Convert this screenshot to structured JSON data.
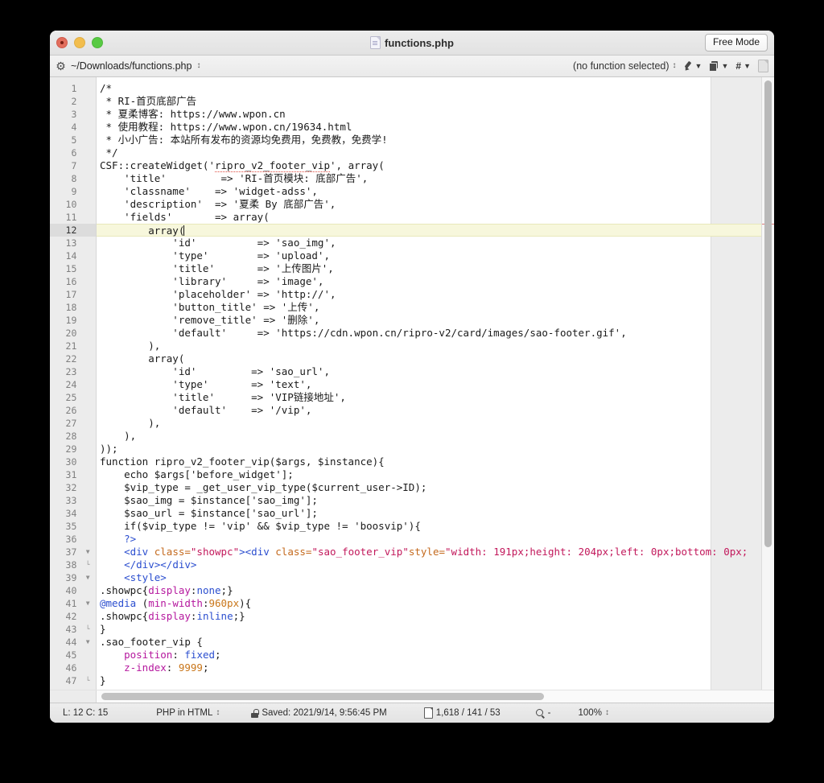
{
  "window": {
    "title": "functions.php",
    "title_icon": "php-file-icon",
    "free_mode_label": "Free Mode",
    "traffic_lights": [
      "close-button",
      "minimize-button",
      "maximize-button"
    ]
  },
  "toolbar": {
    "gear_icon": "gear-icon",
    "path": "~/Downloads/functions.php",
    "path_stepper": "⌃⌄",
    "function_selector": "(no function selected)",
    "icons": [
      "pen-icon",
      "chevron-down-icon",
      "pages-icon",
      "chevron-down-icon",
      "hash-icon",
      "chevron-down-icon",
      "page-icon"
    ]
  },
  "editor": {
    "active_line": 12,
    "margin_guide_column": 80,
    "lines": [
      {
        "n": 1,
        "fold": "",
        "html": "/*"
      },
      {
        "n": 2,
        "fold": "",
        "html": " * RI-首页底部广告"
      },
      {
        "n": 3,
        "fold": "",
        "html": " * 夏柔博客: https://www.wpon.cn"
      },
      {
        "n": 4,
        "fold": "",
        "html": " * 使用教程: https://www.wpon.cn/19634.html"
      },
      {
        "n": 5,
        "fold": "",
        "html": " * 小小广告: 本站所有发布的资源均免费用，免费教，免费学!"
      },
      {
        "n": 6,
        "fold": "",
        "html": " */"
      },
      {
        "n": 7,
        "fold": "",
        "html": "CSF::createWidget('<span class=\"spell\">ripro_v2_footer_vip</span>', array("
      },
      {
        "n": 8,
        "fold": "",
        "html": "    'title'         => 'RI-首页模块: 底部广告',"
      },
      {
        "n": 9,
        "fold": "",
        "html": "    'classname'    => 'widget-adss',"
      },
      {
        "n": 10,
        "fold": "",
        "html": "    'description'  => '夏柔 By 底部广告',"
      },
      {
        "n": 11,
        "fold": "",
        "html": "    'fields'       => array("
      },
      {
        "n": 12,
        "fold": "",
        "html": "        array(<span class=\"caret\"></span>"
      },
      {
        "n": 13,
        "fold": "",
        "html": "            'id'          => 'sao_img',"
      },
      {
        "n": 14,
        "fold": "",
        "html": "            'type'        => 'upload',"
      },
      {
        "n": 15,
        "fold": "",
        "html": "            'title'       => '上传图片',"
      },
      {
        "n": 16,
        "fold": "",
        "html": "            'library'     => 'image',"
      },
      {
        "n": 17,
        "fold": "",
        "html": "            'placeholder' => 'http://',"
      },
      {
        "n": 18,
        "fold": "",
        "html": "            'button_title' => '上传',"
      },
      {
        "n": 19,
        "fold": "",
        "html": "            'remove_title' => '删除',"
      },
      {
        "n": 20,
        "fold": "",
        "html": "            'default'     => 'https://cdn.wpon.cn/ripro-v2/card/images/sao-footer.gif',"
      },
      {
        "n": 21,
        "fold": "",
        "html": "        ),"
      },
      {
        "n": 22,
        "fold": "",
        "html": "        array("
      },
      {
        "n": 23,
        "fold": "",
        "html": "            'id'         => 'sao_url',"
      },
      {
        "n": 24,
        "fold": "",
        "html": "            'type'       => 'text',"
      },
      {
        "n": 25,
        "fold": "",
        "html": "            'title'      => 'VIP链接地址',"
      },
      {
        "n": 26,
        "fold": "",
        "html": "            'default'    => '/vip',"
      },
      {
        "n": 27,
        "fold": "",
        "html": "        ),"
      },
      {
        "n": 28,
        "fold": "",
        "html": "    ),"
      },
      {
        "n": 29,
        "fold": "",
        "html": "));"
      },
      {
        "n": 30,
        "fold": "",
        "html": "function ripro_v2_footer_vip($args, $instance){"
      },
      {
        "n": 31,
        "fold": "",
        "html": "    echo $args['before_widget'];"
      },
      {
        "n": 32,
        "fold": "",
        "html": "    $vip_type = _get_user_vip_type($current_user->ID);"
      },
      {
        "n": 33,
        "fold": "",
        "html": "    $sao_img = $instance['sao_img'];"
      },
      {
        "n": 34,
        "fold": "",
        "html": "    $sao_url = $instance['sao_url'];"
      },
      {
        "n": 35,
        "fold": "",
        "html": "    if($vip_type != 'vip' && $vip_type != 'boosvip'){"
      },
      {
        "n": 36,
        "fold": "",
        "html": "    <span class=\"s-php\">?&gt;</span>"
      },
      {
        "n": 37,
        "fold": "▼",
        "html": "    <span class=\"s-tag\">&lt;div </span><span class=\"s-attr\">class=</span><span class=\"s-str\">\"showpc\"</span><span class=\"s-tag\">&gt;&lt;div </span><span class=\"s-attr\">class=</span><span class=\"s-str\">\"sao_footer_vip\"</span><span class=\"s-attr\">style=</span><span class=\"s-str\">\"width: 191px;height: 204px;left: 0px;bottom: 0px;</span>"
      },
      {
        "n": 38,
        "fold": "└",
        "html": "    <span class=\"s-tag\">&lt;/div&gt;&lt;/div&gt;</span>"
      },
      {
        "n": 39,
        "fold": "▼",
        "html": "    <span class=\"s-tag\">&lt;style&gt;</span>"
      },
      {
        "n": 40,
        "fold": "",
        "html": ".showpc{<span class=\"s-prop\">display</span>:<span class=\"s-val\">none</span>;}"
      },
      {
        "n": 41,
        "fold": "▼",
        "html": "<span class=\"s-at\">@media</span> (<span class=\"s-prop\">min-width</span>:<span class=\"s-num\">960px</span>){"
      },
      {
        "n": 42,
        "fold": "",
        "html": ".showpc{<span class=\"s-prop\">display</span>:<span class=\"s-val\">inline</span>;}"
      },
      {
        "n": 43,
        "fold": "└",
        "html": "}"
      },
      {
        "n": 44,
        "fold": "▼",
        "html": ".sao_footer_vip {"
      },
      {
        "n": 45,
        "fold": "",
        "html": "    <span class=\"s-prop\">position</span>: <span class=\"s-val\">fixed</span>;"
      },
      {
        "n": 46,
        "fold": "",
        "html": "    <span class=\"s-prop\">z-index</span>: <span class=\"s-num\">9999</span>;"
      },
      {
        "n": 47,
        "fold": "└",
        "html": "}"
      }
    ]
  },
  "statusbar": {
    "cursor_position": "L: 12 C: 15",
    "language": "PHP in HTML",
    "language_stepper": "⌃⌄",
    "lock_icon": "unlocked-icon",
    "saved": "Saved: 2021/9/14, 9:56:45 PM",
    "file_icon": "document-icon",
    "counts": "1,618 / 141 / 53",
    "search_icon": "magnifier-icon",
    "search_value": "-",
    "zoom": "100%",
    "zoom_stepper": "⌃⌄"
  },
  "colors": {
    "accent_tag": "#2b4ecf",
    "accent_attr": "#c46a1e",
    "accent_string": "#c2185b",
    "accent_property": "#b5179e",
    "accent_number": "#c9761a",
    "active_line": "#f7f7dc",
    "spell_underline": "#e04a3f"
  }
}
